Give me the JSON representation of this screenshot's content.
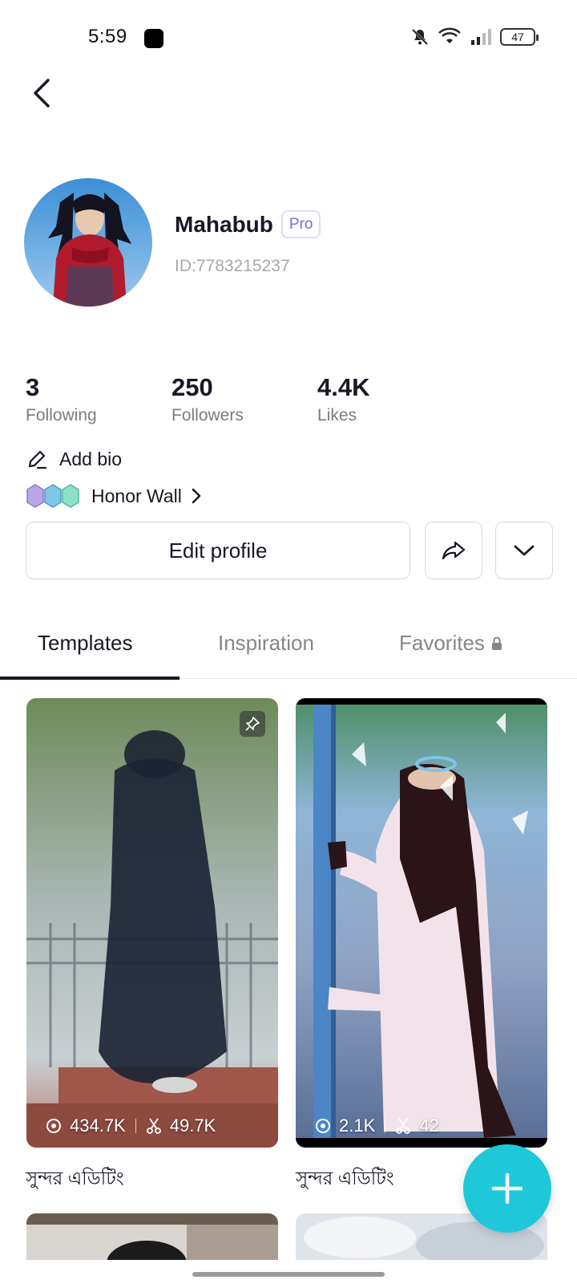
{
  "status_bar": {
    "time": "5:59",
    "battery": "47"
  },
  "profile": {
    "username": "Mahabub",
    "badge": "Pro",
    "user_id": "ID:7783215237"
  },
  "stats": [
    {
      "value": "3",
      "label": "Following"
    },
    {
      "value": "250",
      "label": "Followers"
    },
    {
      "value": "4.4K",
      "label": "Likes"
    }
  ],
  "bio": {
    "label": "Add bio"
  },
  "honor_wall": {
    "label": "Honor Wall"
  },
  "actions": {
    "edit_profile": "Edit profile"
  },
  "tabs": [
    {
      "label": "Templates",
      "active": true
    },
    {
      "label": "Inspiration",
      "active": false
    },
    {
      "label": "Favorites",
      "active": false,
      "locked": true
    }
  ],
  "templates": [
    {
      "title": "সুন্দর এডিটিং",
      "views": "434.7K",
      "uses": "49.7K",
      "pinned": true
    },
    {
      "title": "সুন্দর এডিটিং",
      "views": "2.1K",
      "uses": "42",
      "pinned": false
    }
  ],
  "colors": {
    "accent": "#1ec8d9",
    "pro_badge": "#7a6fd6",
    "text_primary": "#161823",
    "text_secondary": "#7b7c82"
  },
  "icons": {
    "back": "chevron-left-icon",
    "edit": "pencil-icon",
    "share": "share-arrow-icon",
    "more": "chevron-down-icon",
    "lock": "lock-icon",
    "views": "eye-icon",
    "uses": "scissors-icon",
    "pin": "pin-icon",
    "create": "plus-icon"
  }
}
